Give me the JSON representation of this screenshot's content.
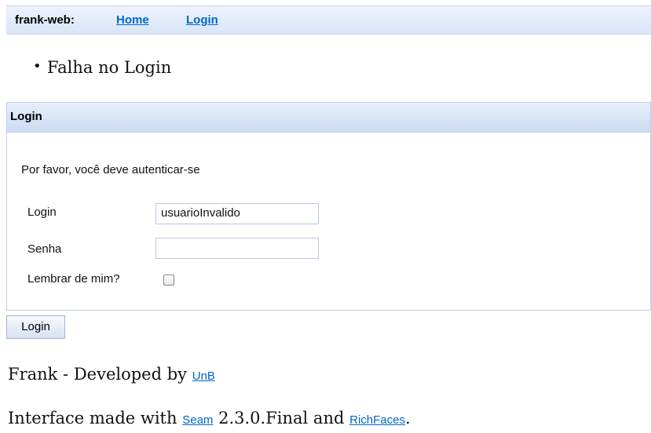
{
  "topbar": {
    "app_name": "frank-web:",
    "home_link": "Home",
    "login_link": "Login"
  },
  "messages": [
    "Falha no Login"
  ],
  "login_panel": {
    "title": "Login",
    "intro": "Por favor, você deve autenticar-se",
    "login_label": "Login",
    "login_value": "usuarioInvalido",
    "password_label": "Senha",
    "password_value": "",
    "remember_label": "Lembrar de mim?",
    "remember_checked": false
  },
  "submit_button": "Login",
  "footer": {
    "line1_text": "Frank - Developed by",
    "line1_link": "UnB",
    "line2_text_before": "Interface made with",
    "line2_link1": "Seam",
    "line2_text_middle": "2.3.0.Final and",
    "line2_link2": "RichFaces",
    "line2_text_end": "."
  }
}
